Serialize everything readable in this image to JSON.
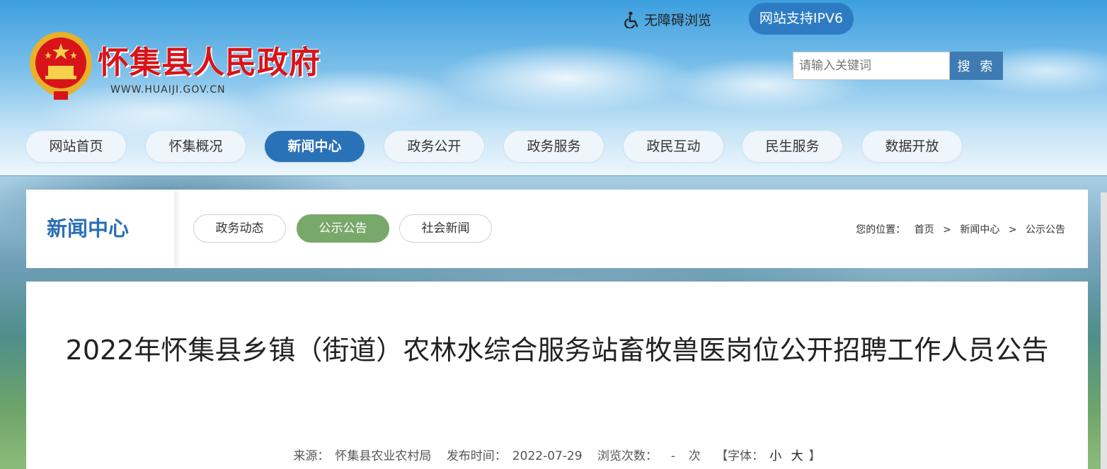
{
  "header": {
    "site_title": "怀集县人民政府",
    "site_url": "WWW.HUAIJI.GOV.CN",
    "accessibility_label": "无障碍浏览",
    "ipv6_label": "网站支持IPV6",
    "search": {
      "placeholder": "请输入关键词",
      "button_label": "搜 索"
    }
  },
  "nav": {
    "items": [
      {
        "label": "网站首页"
      },
      {
        "label": "怀集概况"
      },
      {
        "label": "新闻中心"
      },
      {
        "label": "政务公开"
      },
      {
        "label": "政务服务"
      },
      {
        "label": "政民互动"
      },
      {
        "label": "民生服务"
      },
      {
        "label": "数据开放"
      }
    ],
    "active": "新闻中心"
  },
  "section": {
    "title": "新闻中心",
    "tabs": [
      {
        "label": "政务动态"
      },
      {
        "label": "公示公告"
      },
      {
        "label": "社会新闻"
      }
    ],
    "active_tab": "公示公告"
  },
  "breadcrumb": {
    "prefix": "您的位置：",
    "items": [
      "首页",
      "新闻中心",
      "公示公告"
    ],
    "separator": ">"
  },
  "article": {
    "title": "2022年怀集县乡镇（街道）农林水综合服务站畜牧兽医岗位公开招聘工作人员公告",
    "source_label": "来源：",
    "source": "怀集县农业农村局",
    "date_label": "发布时间：",
    "date": "2022-07-29",
    "views_label": "浏览次数：",
    "views": "-",
    "views_unit": "次",
    "font_label": "【字体：",
    "font_small": "小",
    "font_large": "大",
    "font_close": "】"
  },
  "colors": {
    "primary_blue": "#2a72b8",
    "active_tab_green": "#78a86a",
    "title_red": "#d8141a"
  }
}
